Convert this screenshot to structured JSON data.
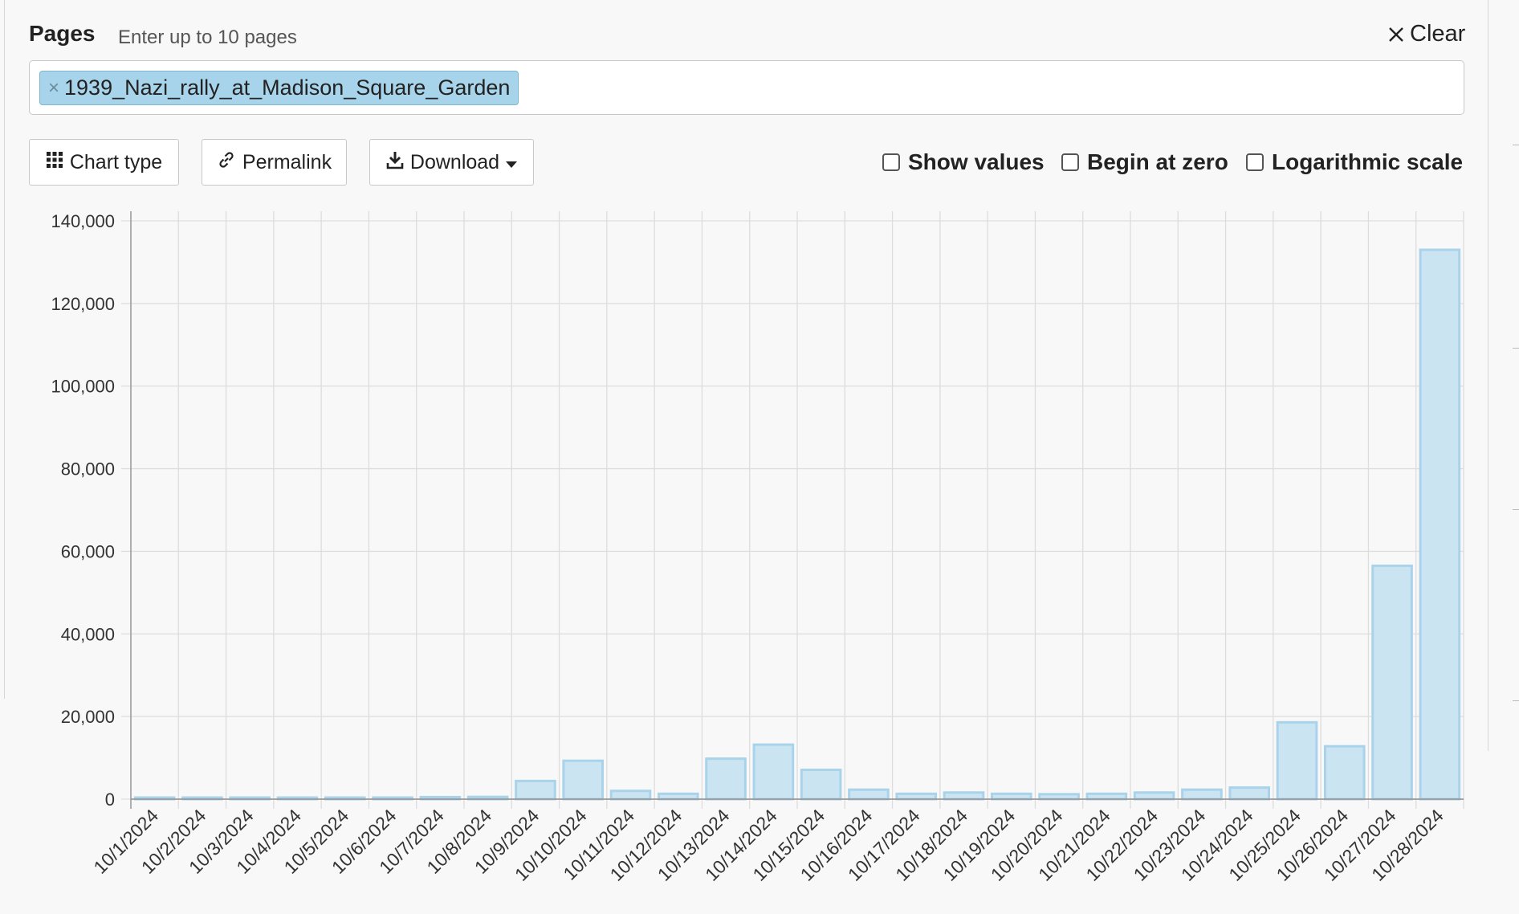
{
  "header": {
    "pages_label": "Pages",
    "pages_hint": "Enter up to 10 pages",
    "clear_label": "Clear"
  },
  "pages": [
    "1939_Nazi_rally_at_Madison_Square_Garden"
  ],
  "toolbar": {
    "chart_type_label": "Chart type",
    "permalink_label": "Permalink",
    "download_label": "Download"
  },
  "options": {
    "show_values_label": "Show values",
    "show_values_checked": false,
    "begin_at_zero_label": "Begin at zero",
    "begin_at_zero_checked": false,
    "log_scale_label": "Logarithmic scale",
    "log_scale_checked": false
  },
  "colors": {
    "bar_fill": "#cbe4f2",
    "bar_stroke": "#a9d3ea",
    "grid": "#dddddd",
    "axis": "#999999"
  },
  "chart_data": {
    "type": "bar",
    "series": [
      {
        "values": [
          150,
          200,
          200,
          150,
          180,
          180,
          500,
          550,
          4400,
          9300,
          2000,
          1300,
          9800,
          13200,
          7100,
          2300,
          1300,
          1600,
          1300,
          1200,
          1300,
          1600,
          2300,
          2800,
          18600,
          12800,
          56500,
          133000
        ]
      }
    ],
    "categories": [
      "10/1/2024",
      "10/2/2024",
      "10/3/2024",
      "10/4/2024",
      "10/5/2024",
      "10/6/2024",
      "10/7/2024",
      "10/8/2024",
      "10/9/2024",
      "10/10/2024",
      "10/11/2024",
      "10/12/2024",
      "10/13/2024",
      "10/14/2024",
      "10/15/2024",
      "10/16/2024",
      "10/17/2024",
      "10/18/2024",
      "10/19/2024",
      "10/20/2024",
      "10/21/2024",
      "10/22/2024",
      "10/23/2024",
      "10/24/2024",
      "10/25/2024",
      "10/26/2024",
      "10/27/2024",
      "10/28/2024"
    ],
    "y_ticks": [
      "0",
      "20,000",
      "40,000",
      "60,000",
      "80,000",
      "100,000",
      "120,000",
      "140,000"
    ],
    "ylim": [
      0,
      140000
    ],
    "grid": true,
    "legend": false
  }
}
